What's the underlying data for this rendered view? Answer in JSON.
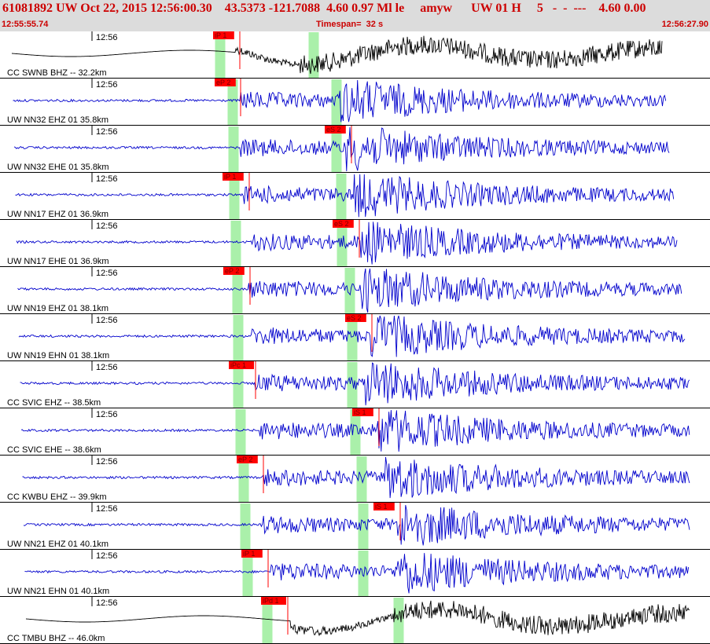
{
  "header": {
    "title": "61081892 UW Oct 22, 2015 12:56:00.30    43.5373 -121.7088  4.60 0.97 Ml le     amyw      UW 01 H     5   -  -  ---    4.60 0.00",
    "start_time": "12:55:55.74",
    "timespan": "Timespan=  32 s",
    "end_time": "12:56:27.90"
  },
  "colors": {
    "header_bg": "#dcdcdc",
    "header_text": "#cc0000",
    "trace_blue": "#0000cc",
    "trace_black": "#000000",
    "pick_red": "#ff0000",
    "window_green": "#aaf0aa"
  },
  "traces": [
    {
      "label": "CC SWNB BHZ -- 32.2km",
      "tick": "12:56",
      "pick": "iP 1",
      "color": "black",
      "p_pick": 291,
      "s_pick": 305,
      "green": [
        280,
        399
      ],
      "onset": 300,
      "s_onset": 380,
      "long_period": true
    },
    {
      "label": "UW NN32 EHZ 01 35.8km",
      "tick": "12:56",
      "pick": "eP 2",
      "color": "blue",
      "p_pick": 293,
      "s_pick": 306,
      "green": [
        296,
        428
      ],
      "onset": 305,
      "s_onset": 430
    },
    {
      "label": "UW NN32 EHE 01 35.8km",
      "tick": "12:56",
      "pick": "eS 2",
      "color": "blue",
      "p_pick": 433,
      "s_pick": 447,
      "green": [
        297,
        428
      ],
      "onset": 305,
      "s_onset": 440
    },
    {
      "label": "UW NN17 EHZ 01 36.9km",
      "tick": "12:56",
      "pick": "iP 1",
      "color": "blue",
      "p_pick": 303,
      "s_pick": 317,
      "green": [
        298,
        434
      ],
      "onset": 310,
      "s_onset": 450
    },
    {
      "label": "UW NN17 EHE 01 36.9km",
      "tick": "12:56",
      "pick": "eS 2",
      "color": "blue",
      "p_pick": 443,
      "s_pick": 457,
      "green": [
        300,
        435
      ],
      "onset": 320,
      "s_onset": 455
    },
    {
      "label": "UW NN19 EHZ 01 38.1km",
      "tick": "12:56",
      "pick": "eP 2",
      "color": "blue",
      "p_pick": 304,
      "s_pick": 318,
      "green": [
        302,
        445
      ],
      "onset": 315,
      "s_onset": 460
    },
    {
      "label": "UW NN19 EHN 01 38.1km",
      "tick": "12:56",
      "pick": "eS 2",
      "color": "blue",
      "p_pick": 459,
      "s_pick": 473,
      "green": [
        303,
        448
      ],
      "onset": 320,
      "s_onset": 470
    },
    {
      "label": "CC SVIC EHZ -- 38.5km",
      "tick": "12:56",
      "pick": "iPc 1",
      "color": "blue",
      "p_pick": 311,
      "s_pick": 325,
      "green": [
        303,
        448
      ],
      "onset": 325,
      "s_onset": 465
    },
    {
      "label": "CC SVIC EHE -- 38.6km",
      "tick": "12:56",
      "pick": "iS 1",
      "color": "blue",
      "p_pick": 468,
      "s_pick": 482,
      "green": [
        306,
        452
      ],
      "onset": 330,
      "s_onset": 480
    },
    {
      "label": "CC KWBU EHZ -- 39.9km",
      "tick": "12:56",
      "pick": "eP 2",
      "color": "blue",
      "p_pick": 321,
      "s_pick": 335,
      "green": [
        310,
        460
      ],
      "onset": 335,
      "s_onset": 490
    },
    {
      "label": "UW NN21 EHZ 01 40.1km",
      "tick": "12:56",
      "pick": "iS 1",
      "color": "blue",
      "p_pick": 495,
      "s_pick": 509,
      "green": [
        312,
        462
      ],
      "onset": 330,
      "s_onset": 505
    },
    {
      "label": "UW NN21 EHN 01 40.1km",
      "tick": "12:56",
      "pick": "iP 1",
      "color": "blue",
      "p_pick": 327,
      "s_pick": 341,
      "green": [
        315,
        462
      ],
      "onset": 345,
      "s_onset": 505
    },
    {
      "label": "CC TMBU BHZ -- 46.0km",
      "tick": "12:56",
      "pick": "iPd 1",
      "color": "black",
      "p_pick": 352,
      "s_pick": 366,
      "green": [
        340,
        507
      ],
      "onset": 370,
      "s_onset": 500,
      "long_period": true
    }
  ]
}
